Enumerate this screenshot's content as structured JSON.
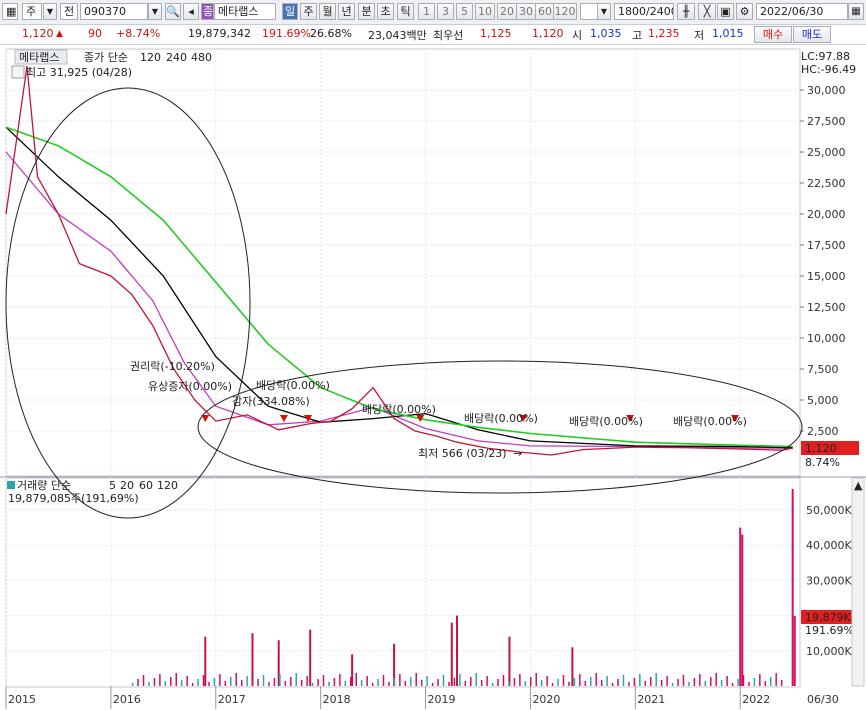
{
  "toolbar": {
    "type": "주",
    "code_label": "전",
    "code": "090370",
    "name_badge": "종",
    "name": "메타랩스",
    "periods": [
      "일",
      "주",
      "월",
      "년",
      "분",
      "초",
      "틱"
    ],
    "intervals": [
      "1",
      "3",
      "5",
      "10",
      "20",
      "30",
      "60",
      "120"
    ],
    "count": "1800",
    "count_max": "/2400",
    "date": "2022/06/30"
  },
  "info": {
    "price": "1,120",
    "change": "90",
    "change_pct": "+8.74%",
    "volume": "19,879,342",
    "volume_pct": "191.69%",
    "turnover": "26.68%",
    "amount": "23,043백만",
    "priority_label": "최우선",
    "ask": "1,125",
    "bid": "1,120",
    "open_label": "시",
    "open": "1,035",
    "high_label": "고",
    "high": "1,235",
    "low_label": "저",
    "low": "1,015",
    "buy": "매수",
    "sell": "매도"
  },
  "legend": {
    "name": "메타랩스",
    "ma_prefix": "종가 단순",
    "ma_120": "120",
    "ma_240": "240",
    "ma_480": "480",
    "vol_prefix": "거래량 단순",
    "vol_5": "5",
    "vol_20": "20",
    "vol_60": "60",
    "vol_120": "120",
    "vol_value": "19,879,085주(191,69%)"
  },
  "annotations": {
    "high": "최고 31,925 (04/28)",
    "low": "최저 566 (03/23)",
    "rights": "권리락(-10.20%)",
    "paid_increase": "유상증자(0.00%)",
    "reduction": "감자(334.08%)",
    "div1": "배당락(0.00%)",
    "div2": "배당락(0.00%)",
    "div3": "배당락(0.00%)",
    "div4": "배당락(0.00%)",
    "div5": "배당락(0.00%)",
    "lc": "LC:97.88",
    "hc": "HC:-96.49",
    "price_tag": "1,120",
    "price_tag_pct": "8.74%",
    "vol_tag": "19,879K",
    "vol_tag_pct": "191.69%",
    "date_end": "06/30"
  },
  "colors": {
    "ma120": "#c03cc0",
    "ma240": "#000000",
    "ma480": "#22cc22",
    "up": "#d01010",
    "down": "#1a2ed0",
    "price_tag": "#e02020"
  },
  "chart_data": {
    "type": "line",
    "title": "메타랩스",
    "x_ticks": [
      "2015",
      "2016",
      "2017",
      "2018",
      "2019",
      "2020",
      "2021",
      "2022"
    ],
    "price_axis": {
      "ticks": [
        "30,000",
        "27,500",
        "25,000",
        "22,500",
        "20,000",
        "17,500",
        "15,000",
        "12,500",
        "10,000",
        "7,500",
        "5,000",
        "2,500"
      ],
      "ylim": [
        0,
        32500
      ]
    },
    "volume_axis": {
      "ticks": [
        "50,000K",
        "40,000K",
        "30,000K",
        "20,000K",
        "10,000K"
      ],
      "ylim": [
        0,
        58000
      ]
    },
    "series": [
      {
        "name": "120",
        "x": [
          2015.0,
          2015.5,
          2016.0,
          2016.4,
          2016.7,
          2017.0,
          2017.5,
          2018.0,
          2018.5,
          2019.0,
          2019.5,
          2020.0,
          2021.0,
          2022.0,
          2022.5
        ],
        "y": [
          25000,
          20000,
          17000,
          13000,
          8000,
          4500,
          3000,
          3300,
          4400,
          2700,
          1700,
          1300,
          1250,
          1150,
          1100
        ]
      },
      {
        "name": "240",
        "x": [
          2015.0,
          2015.5,
          2016.0,
          2016.5,
          2017.0,
          2017.5,
          2018.0,
          2018.5,
          2019.0,
          2019.5,
          2020.0,
          2021.0,
          2022.0,
          2022.5
        ],
        "y": [
          27000,
          23000,
          19500,
          15000,
          8500,
          4500,
          3200,
          3500,
          3900,
          2600,
          1700,
          1300,
          1250,
          1150
        ]
      },
      {
        "name": "480",
        "x": [
          2015.0,
          2015.5,
          2016.0,
          2016.5,
          2017.0,
          2017.5,
          2018.0,
          2018.5,
          2019.0,
          2019.5,
          2020.0,
          2021.0,
          2022.0,
          2022.5
        ],
        "y": [
          27000,
          25500,
          23000,
          19500,
          14500,
          9500,
          6000,
          4300,
          3400,
          2800,
          2300,
          1600,
          1350,
          1250
        ]
      },
      {
        "name": "종가",
        "x": [
          2015.0,
          2015.2,
          2015.3,
          2015.5,
          2015.7,
          2016.0,
          2016.2,
          2016.4,
          2016.6,
          2016.8,
          2017.0,
          2017.3,
          2017.6,
          2017.9,
          2018.1,
          2018.3,
          2018.5,
          2018.7,
          2018.9,
          2019.1,
          2019.3,
          2019.6,
          2019.9,
          2020.2,
          2020.5,
          2021.0,
          2021.5,
          2022.0,
          2022.4,
          2022.5
        ],
        "y": [
          20000,
          31925,
          23000,
          20000,
          16000,
          15000,
          13500,
          11000,
          7500,
          5000,
          3300,
          3800,
          2600,
          3100,
          3300,
          4300,
          6000,
          3500,
          2500,
          2100,
          1600,
          1100,
          800,
          566,
          1000,
          1200,
          1150,
          1050,
          950,
          1120
        ]
      }
    ],
    "volume_peaks_k": [
      14000,
      15000,
      13000,
      16000,
      9000,
      12000,
      18000,
      20000,
      14000,
      11000,
      45000,
      43000,
      56000,
      19879
    ]
  }
}
